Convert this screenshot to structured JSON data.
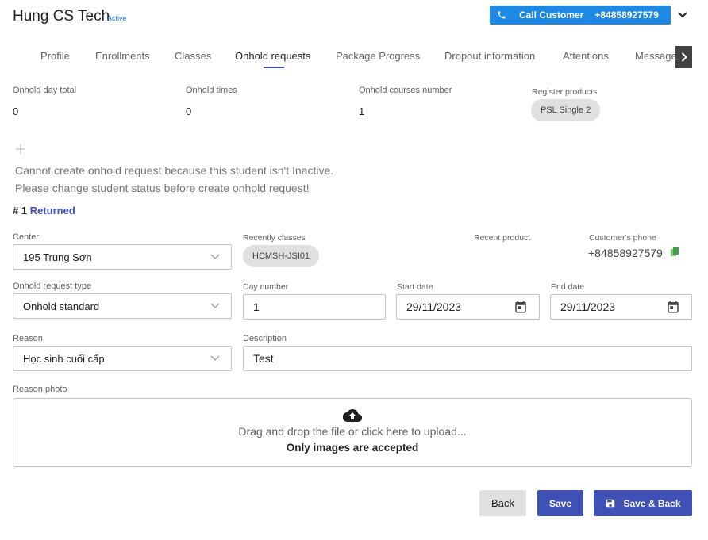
{
  "header": {
    "student_name": "Hung CS Tech",
    "status": "Active",
    "call_label": "Call Customer",
    "call_number": "+84858927579"
  },
  "tabs": [
    {
      "label": "Profile"
    },
    {
      "label": "Enrollments"
    },
    {
      "label": "Classes"
    },
    {
      "label": "Onhold requests",
      "active": true
    },
    {
      "label": "Package Progress"
    },
    {
      "label": "Dropout information"
    },
    {
      "label": "Attentions"
    },
    {
      "label": "Messages"
    }
  ],
  "summary": {
    "onhold_day_total_label": "Onhold day total",
    "onhold_day_total": "0",
    "onhold_times_label": "Onhold times",
    "onhold_times": "0",
    "onhold_courses_label": "Onhold courses number",
    "onhold_courses": "1",
    "register_products_label": "Register products",
    "register_product": "PSL Single 2"
  },
  "notice": {
    "line1": "Cannot create onhold request because this student isn't Inactive.",
    "line2": "Please change student status before create onhold request!"
  },
  "request": {
    "number": "# 1",
    "status": "Returned",
    "center_label": "Center",
    "center_value": "195 Trung Sơn",
    "recent_classes_label": "Recently classes",
    "recent_class": "HCMSH-JSI01",
    "recent_product_label": "Recent product",
    "customer_phone_label": "Customer's phone",
    "customer_phone": "+84858927579",
    "type_label": "Onhold request type",
    "type_value": "Onhold standard",
    "day_number_label": "Day number",
    "day_number": "1",
    "start_date_label": "Start date",
    "start_date": "29/11/2023",
    "end_date_label": "End date",
    "end_date": "29/11/2023",
    "reason_label": "Reason",
    "reason_value": "Học sinh cuối cấp",
    "description_label": "Description",
    "description_value": "Test",
    "reason_photo_label": "Reason photo",
    "dropzone_text": "Drag and drop the file or click here to upload...",
    "dropzone_hint": "Only images are accepted"
  },
  "actions": {
    "back": "Back",
    "save": "Save",
    "save_back": "Save & Back"
  },
  "colors": {
    "primary": "#3f51b5",
    "call_button": "#1e88e5",
    "copy_icon": "#43a047"
  }
}
